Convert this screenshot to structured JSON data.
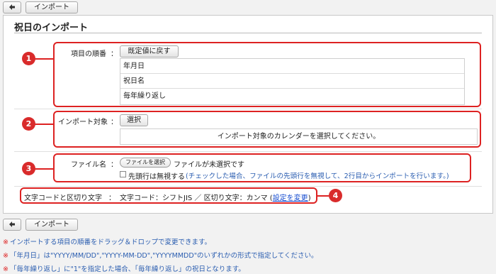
{
  "toolbar": {
    "import_label": "インポート"
  },
  "page": {
    "title": "祝日のインポート"
  },
  "order": {
    "label": "項目の順番",
    "colon": "：",
    "reset_label": "既定値に戻す",
    "items": [
      {
        "label": "年月日"
      },
      {
        "label": "祝日名"
      },
      {
        "label": "毎年繰り返し"
      }
    ]
  },
  "target": {
    "label": "インポート対象",
    "colon": "：",
    "select_label": "選択",
    "placeholder": "インポート対象のカレンダーを選択してください。"
  },
  "file": {
    "label": "ファイル名",
    "colon": "：",
    "choose_label": "ファイルを選択",
    "status": "ファイルが未選択です",
    "skip_first_label": "先頭行は無視する",
    "skip_first_hint": "(チェックした場合、ファイルの先頭行を無視して、2行目からインポートを行います。)"
  },
  "encoding": {
    "label": "文字コードと区切り文字",
    "colon": "：",
    "value": "文字コード：シフトJIS ／ 区切り文字：カンマ (",
    "link": "設定を変更",
    "close_paren": ")"
  },
  "callouts": [
    "1",
    "2",
    "3",
    "4"
  ],
  "notes": [
    {
      "mark": "※",
      "text": "インポートする項目の順番をドラッグ＆ドロップで変更できます。"
    },
    {
      "mark": "※",
      "text": "「年月日」は\"YYYY/MM/DD\",\"YYYY-MM-DD\",\"YYYYMMDD\"のいずれかの形式で指定してください。"
    },
    {
      "mark": "※",
      "text": "「毎年繰り返し」に\"1\"を指定した場合、「毎年繰り返し」の祝日となります。"
    }
  ],
  "colors": {
    "callout": "#d22",
    "hint": "#2a5db0",
    "link": "#1a4fd0"
  },
  "icons": {
    "back": "back-arrow-icon"
  }
}
